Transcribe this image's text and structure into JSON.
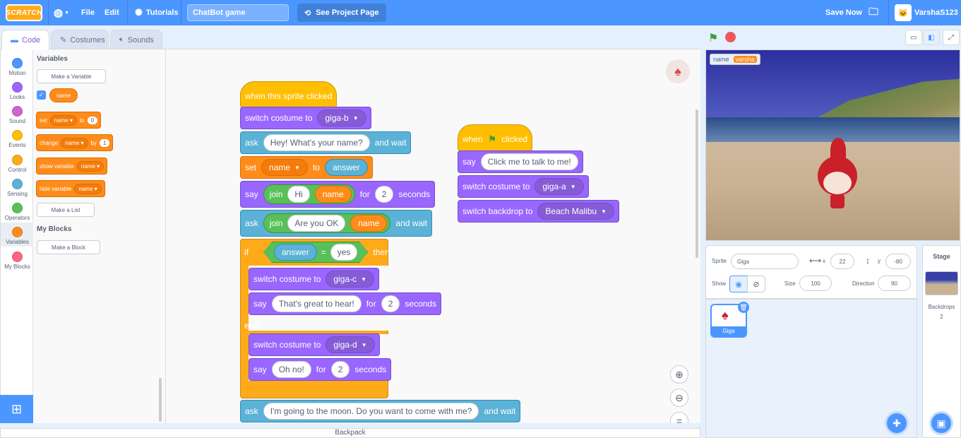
{
  "menubar": {
    "logo": "SCRATCH",
    "file": "File",
    "edit": "Edit",
    "tutorials": "Tutorials",
    "project_title": "ChatBot game",
    "see_project_page": "See Project Page",
    "save_now": "Save Now",
    "username": "VarshaS123"
  },
  "tabs": {
    "code": "Code",
    "costumes": "Costumes",
    "sounds": "Sounds"
  },
  "categories": [
    {
      "label": "Motion",
      "color": "#4c97ff"
    },
    {
      "label": "Looks",
      "color": "#9966ff"
    },
    {
      "label": "Sound",
      "color": "#cf63cf"
    },
    {
      "label": "Events",
      "color": "#ffbf00"
    },
    {
      "label": "Control",
      "color": "#ffab19"
    },
    {
      "label": "Sensing",
      "color": "#5cb1d6"
    },
    {
      "label": "Operators",
      "color": "#59c059"
    },
    {
      "label": "Variables",
      "color": "#ff8c1a"
    },
    {
      "label": "My Blocks",
      "color": "#ff6680"
    }
  ],
  "palette": {
    "variables_heading": "Variables",
    "make_variable": "Make a Variable",
    "variable_name": "name",
    "set_block": {
      "a": "set",
      "var": "name",
      "b": "to",
      "val": "0"
    },
    "change_block": {
      "a": "change",
      "var": "name",
      "b": "by",
      "val": "1"
    },
    "show_block": {
      "a": "show variable",
      "var": "name"
    },
    "hide_block": {
      "a": "hide variable",
      "var": "name"
    },
    "make_list": "Make a List",
    "my_blocks_heading": "My Blocks",
    "make_block": "Make a Block"
  },
  "script1": {
    "hat": "when this sprite clicked",
    "switch1": {
      "a": "switch costume to",
      "costume": "giga-b"
    },
    "ask1": {
      "a": "ask",
      "q": "Hey! What's your name?",
      "b": "and wait"
    },
    "set1": {
      "a": "set",
      "var": "name",
      "b": "to",
      "val": "answer"
    },
    "say1": {
      "a": "say",
      "join": "join",
      "s1": "Hi",
      "s2": "name",
      "b": "for",
      "secs": "2",
      "c": "seconds"
    },
    "ask2": {
      "a": "ask",
      "join": "join",
      "s1": "Are you OK",
      "s2": "name",
      "b": "and wait"
    },
    "if": {
      "a": "if",
      "left": "answer",
      "op": "=",
      "right": "yes",
      "b": "then"
    },
    "switch2": {
      "a": "switch costume to",
      "costume": "giga-c"
    },
    "say2": {
      "a": "say",
      "msg": "That's great to hear!",
      "b": "for",
      "secs": "2",
      "c": "seconds"
    },
    "else": "else",
    "switch3": {
      "a": "switch costume to",
      "costume": "giga-d"
    },
    "say3": {
      "a": "say",
      "msg": "Oh no!",
      "b": "for",
      "secs": "2",
      "c": "seconds"
    },
    "ask3": {
      "a": "ask",
      "q": "I'm going to the moon. Do you want to come with me?",
      "b": "and wait"
    }
  },
  "script2": {
    "hat_a": "when",
    "hat_b": "clicked",
    "say": {
      "a": "say",
      "msg": "Click me to talk to me!"
    },
    "switch": {
      "a": "switch costume to",
      "costume": "giga-a"
    },
    "backdrop": {
      "a": "switch backdrop to",
      "backdrop": "Beach Malibu"
    }
  },
  "backpack": "Backpack",
  "stage": {
    "monitor_label": "name",
    "monitor_value": "varsha"
  },
  "sprite_info": {
    "sprite_label": "Sprite",
    "sprite_name": "Giga",
    "x_label": "x",
    "x": "22",
    "y_label": "y",
    "y": "-80",
    "show_label": "Show",
    "size_label": "Size",
    "size": "100",
    "direction_label": "Direction",
    "direction": "90"
  },
  "sprites": [
    {
      "name": "Giga"
    }
  ],
  "stage_pane": {
    "title": "Stage",
    "backdrops_label": "Backdrops",
    "backdrops_count": "2"
  }
}
